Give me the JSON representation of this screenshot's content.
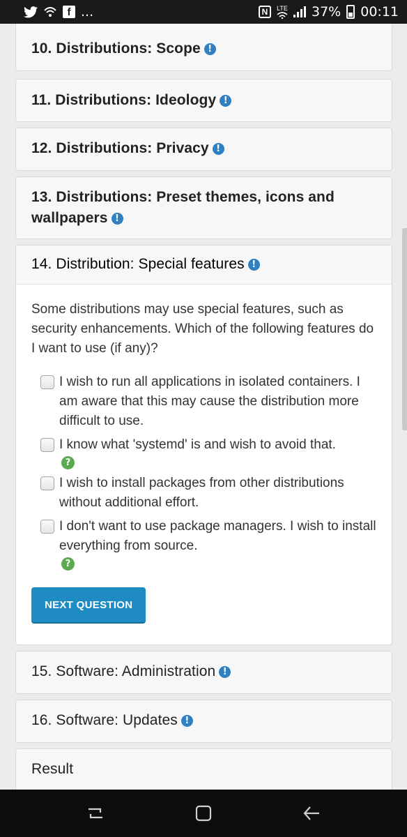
{
  "status_bar": {
    "battery_percent": "37%",
    "time": "00:11",
    "ellipsis": "...",
    "network": "LTE"
  },
  "panels": {
    "p10": "10. Distributions: Scope",
    "p11": "11. Distributions: Ideology",
    "p12": "12. Distributions: Privacy",
    "p13_line1": "13. Distributions: Preset themes, icons and",
    "p13_line2": "wallpapers",
    "p14": "14. Distribution: Special features",
    "p15": "15. Software: Administration",
    "p16": "16. Software: Updates",
    "result": "Result"
  },
  "question": {
    "text": "Some distributions may use special features, such as security enhancements. Which of the following features do I want to use (if any)?",
    "options": [
      {
        "label": "I wish to run all applications in isolated containers. I am aware that this may cause the distribution more difficult to use.",
        "checked": false,
        "has_help": false
      },
      {
        "label": "I know what 'systemd' is and wish to avoid that.",
        "checked": false,
        "has_help": true
      },
      {
        "label": "I wish to install packages from other distributions without additional effort.",
        "checked": false,
        "has_help": false
      },
      {
        "label": "I don't want to use package managers. I wish to install everything from source.",
        "checked": false,
        "has_help": true
      }
    ],
    "next_button": "NEXT QUESTION"
  },
  "icons": {
    "info": "!",
    "help": "?"
  },
  "colors": {
    "accent": "#1e8bc3",
    "info_icon": "#2f80c2",
    "help_icon": "#5aab4f"
  }
}
